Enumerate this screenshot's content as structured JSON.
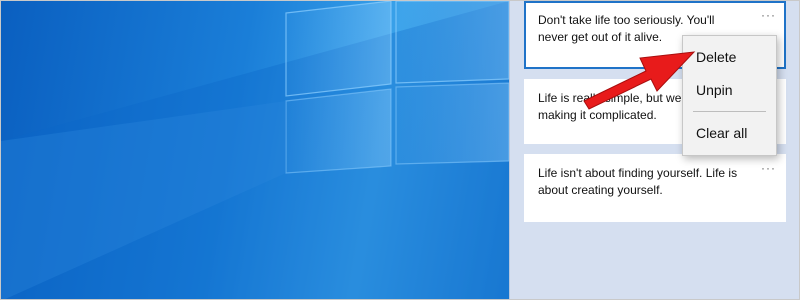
{
  "clipboard": {
    "items": [
      {
        "text": "Don't take life too seriously. You'll never get out of it alive."
      },
      {
        "text": "Life is really simple, but we insist on making it complicated."
      },
      {
        "text": "Life isn't about finding yourself. Life is about creating yourself."
      }
    ],
    "more_icon": "···"
  },
  "context_menu": {
    "delete_label": "Delete",
    "unpin_label": "Unpin",
    "clear_all_label": "Clear all"
  },
  "colors": {
    "selection_border": "#1f73c8",
    "arrow": "#e81b1b",
    "flyout_background": "#d5dff0"
  }
}
